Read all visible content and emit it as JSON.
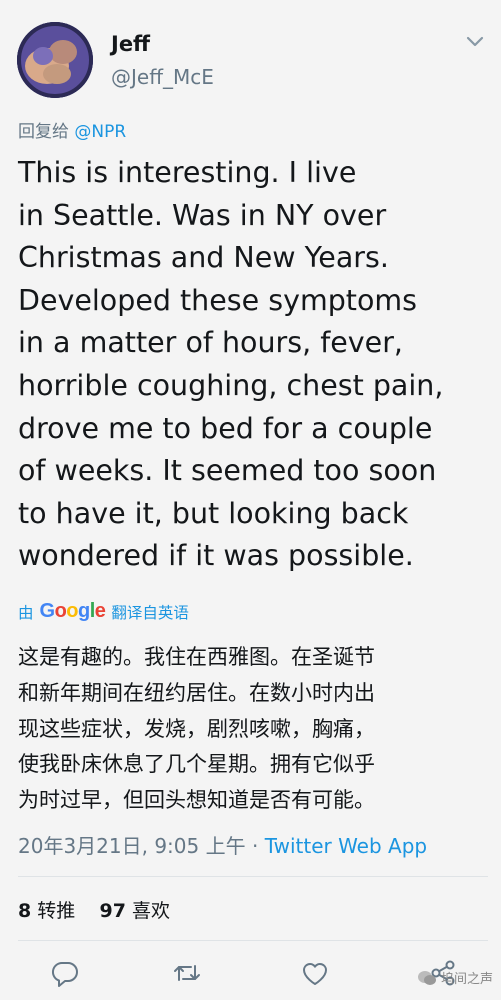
{
  "user": {
    "display_name": "Jeff",
    "handle": "@Jeff_McE"
  },
  "reply": {
    "prefix": "回复给",
    "mention": "@NPR"
  },
  "tweet": {
    "lines": [
      "This is interesting. I live",
      "in Seattle. Was in NY over",
      "Christmas and New Years.",
      "Developed these symptoms",
      "in a matter of hours, fever,",
      "horrible coughing, chest pain,",
      "drove me to bed for a couple",
      "of weeks. It seemed too soon",
      "to have it, but looking back",
      "wondered if it was possible."
    ]
  },
  "translate": {
    "by": "由",
    "google": "Google",
    "from": "翻译自英语"
  },
  "translation": {
    "lines": [
      "这是有趣的。我住在西雅图。在圣诞节",
      "和新年期间在纽约居住。在数小时内出",
      "现这些症状，发烧，剧烈咳嗽，胸痛，",
      "使我卧床休息了几个星期。拥有它似乎",
      "为时过早，但回头想知道是否有可能。"
    ]
  },
  "meta": {
    "timestamp": "20年3月21日, 9:05 上午 · ",
    "source": "Twitter Web App"
  },
  "stats": {
    "retweets_count": "8",
    "retweets_label": "转推",
    "likes_count": "97",
    "likes_label": "喜欢"
  },
  "watermark": {
    "text": "坞间之声"
  },
  "colors": {
    "link": "#1b95e0",
    "secondary_text": "#657786",
    "google_blue": "#4285f4",
    "google_red": "#ea4335",
    "google_yellow": "#fbbc05",
    "google_green": "#34a853"
  },
  "icons": [
    "chevron-down-icon",
    "reply-icon",
    "retweet-icon",
    "like-icon",
    "share-icon",
    "watermark-logo-icon"
  ]
}
